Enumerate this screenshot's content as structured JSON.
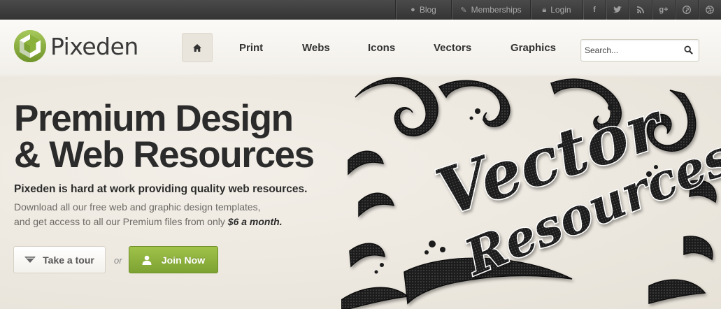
{
  "topbar": {
    "links": [
      {
        "label": "Blog",
        "icon": "chat-bubble-icon"
      },
      {
        "label": "Memberships",
        "icon": "pencil-icon"
      },
      {
        "label": "Login",
        "icon": "lock-icon"
      }
    ],
    "social": [
      {
        "icon": "facebook-icon",
        "glyph": "f"
      },
      {
        "icon": "twitter-icon",
        "glyph": "t"
      },
      {
        "icon": "rss-icon",
        "glyph": "◝"
      },
      {
        "icon": "google-plus-icon",
        "glyph": "g+"
      },
      {
        "icon": "pinterest-icon",
        "glyph": "℗"
      },
      {
        "icon": "dribbble-icon",
        "glyph": "◍"
      }
    ]
  },
  "header": {
    "logo_text": "Pixeden",
    "nav": [
      "Print",
      "Webs",
      "Icons",
      "Vectors",
      "Graphics"
    ],
    "search_placeholder": "Search..."
  },
  "hero": {
    "headline_line1": "Premium Design",
    "headline_line2": "& Web Resources",
    "lead": "Pixeden is hard at work providing quality web resources.",
    "sub_line1": "Download all our free web and graphic design templates,",
    "sub_line2_prefix": "and get access to all our Premium files from only ",
    "sub_price": "$6 a month.",
    "tour_label": "Take a tour",
    "or_label": "or",
    "join_label": "Join Now",
    "art_text_1": "Vector",
    "art_text_2": "Resources"
  },
  "colors": {
    "accent_green": "#8ab13b",
    "topbar_bg": "#3d3d3d",
    "page_bg": "#f0ece4"
  }
}
